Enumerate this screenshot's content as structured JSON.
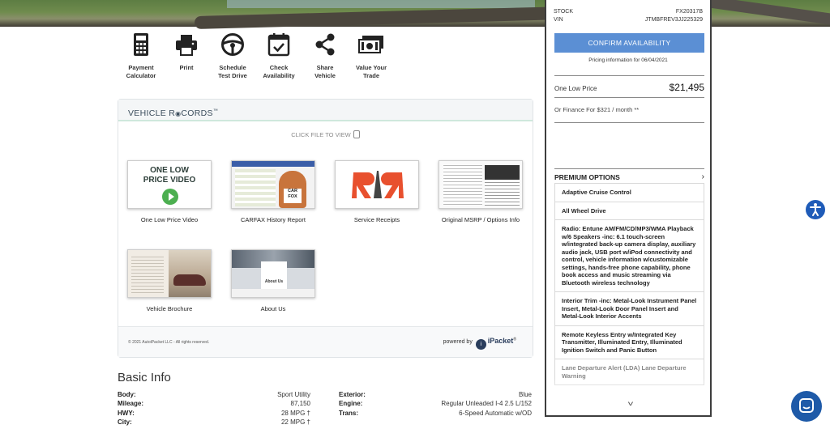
{
  "actions": [
    {
      "label": "Payment\nCalculator",
      "icon": "calculator-icon"
    },
    {
      "label": "Print",
      "icon": "printer-icon"
    },
    {
      "label": "Schedule\nTest Drive",
      "icon": "steering-wheel-icon"
    },
    {
      "label": "Check\nAvailability",
      "icon": "calendar-check-icon"
    },
    {
      "label": "Share\nVehicle",
      "icon": "share-icon"
    },
    {
      "label": "Value Your\nTrade",
      "icon": "cash-icon"
    }
  ],
  "records": {
    "title": "VEHICLE R",
    "title_tail": "CORDS",
    "tm": "™",
    "click_hint": "CLICK FILE TO VIEW",
    "files": [
      {
        "caption": "One Low Price Video",
        "thumb_text_1": "ONE LOW",
        "thumb_text_2": "PRICE VIDEO"
      },
      {
        "caption": "CARFAX History Report",
        "thumb_text_1": "CAR",
        "thumb_text_2": "FOX"
      },
      {
        "caption": "Service Receipts"
      },
      {
        "caption": "Original MSRP / Options Info"
      },
      {
        "caption": "Vehicle Brochure"
      },
      {
        "caption": "About Us",
        "thumb_text_1": "About Us"
      }
    ],
    "copyright": "© 2021 AutoiPacket LLC - All rights reserved.",
    "powered_by": "powered by",
    "brand": "iPacket",
    "brand_mark": "®"
  },
  "basic_info": {
    "title": "Basic Info",
    "left": [
      {
        "k": "Body:",
        "v": "Sport Utility"
      },
      {
        "k": "Mileage:",
        "v": "87,150"
      },
      {
        "k": "HWY:",
        "v": "28 MPG †"
      },
      {
        "k": "City:",
        "v": "22 MPG †"
      }
    ],
    "right": [
      {
        "k": "Exterior:",
        "v": "Blue"
      },
      {
        "k": "Engine:",
        "v": "Regular Unleaded I-4 2.5 L/152"
      },
      {
        "k": "Trans:",
        "v": "6-Speed Automatic w/OD"
      }
    ]
  },
  "sidebar": {
    "stock_label": "STOCK",
    "stock": "FX20317B",
    "vin_label": "VIN",
    "vin": "JTMBFREV3JJ225329",
    "confirm_label": "CONFIRM AVAILABILITY",
    "pricing_date": "Pricing information for 06/04/2021",
    "price_label": "One Low Price",
    "price": "$21,495",
    "finance": "Or Finance For $321 / month **",
    "premium_title": "PREMIUM OPTIONS",
    "options": [
      "Adaptive Cruise Control",
      "All Wheel Drive",
      "Radio: Entune AM/FM/CD/MP3/WMA Playback w/6 Speakers -inc: 6.1 touch-screen w/integrated back-up camera display, auxiliary audio jack, USB port w/iPod connectivity and control, vehicle information w/customizable settings, hands-free phone capability, phone book access and music streaming via Bluetooth wireless technology",
      "Interior Trim -inc: Metal-Look Instrument Panel Insert, Metal-Look Door Panel Insert and Metal-Look Interior Accents",
      "Remote Keyless Entry w/Integrated Key Transmitter, Illuminated Entry, Illuminated Ignition Switch and Panic Button",
      "Lane Departure Alert (LDA) Lane Departure Warning"
    ]
  },
  "colors": {
    "accent": "#5b8fd4",
    "chat": "#1e5aa8",
    "a11y": "#1e5bb8"
  }
}
